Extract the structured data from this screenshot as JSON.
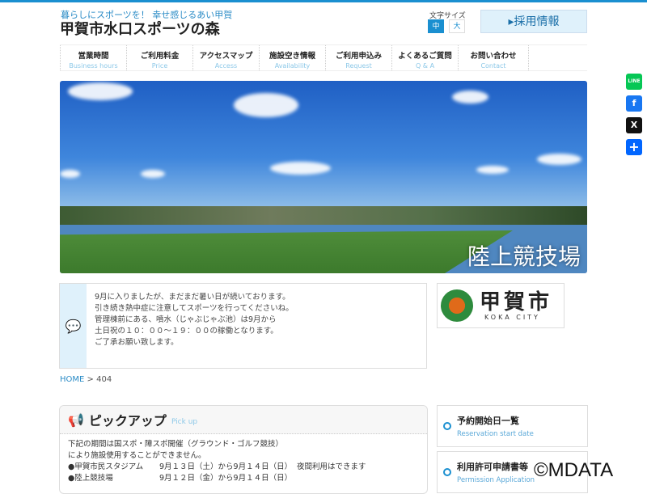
{
  "header": {
    "tagline": "暮らしにスポーツを！ 幸せ感じるあい甲賀",
    "title": "甲賀市水口スポーツの森",
    "font_size_label": "文字サイズ",
    "font_sizes": [
      "中",
      "大"
    ],
    "recruit": "▸採用情報"
  },
  "nav": [
    {
      "ja": "営業時間",
      "en": "Business hours"
    },
    {
      "ja": "ご利用料金",
      "en": "Price"
    },
    {
      "ja": "アクセスマップ",
      "en": "Access"
    },
    {
      "ja": "施設空き情報",
      "en": "Availability"
    },
    {
      "ja": "ご利用申込み",
      "en": "Request"
    },
    {
      "ja": "よくあるご質問",
      "en": "Q & A"
    },
    {
      "ja": "お問い合わせ",
      "en": "Contact"
    }
  ],
  "hero": {
    "caption": "陸上競技場"
  },
  "notice": {
    "lines": [
      "9月に入りましたが、まだまだ暑い日が続いております。",
      "引き続き熱中症に注意してスポーツを行ってくださいね。",
      "管理棟前にある、噴水（じゃぶじゃぶ池）は9月から",
      "土日祝の１０：００～１９：００の稼働となります。",
      "ご了承お願い致します。"
    ]
  },
  "logo": {
    "kanji": "甲賀市",
    "en": "KOKA CITY"
  },
  "breadcrumb": {
    "home": "HOME",
    "sep": ">",
    "current": "404"
  },
  "pickup": {
    "title": "ピックアップ",
    "en": "Pick up",
    "lines": [
      "下記の期間は国スポ・障スポ開催（グラウンド・ゴルフ競技）",
      "により施設使用することができません。"
    ],
    "rows": [
      {
        "place": "●甲賀市民スタジアム",
        "dates": "9月１３日（土）から9月１４日（日）",
        "note": "夜間利用はできます"
      },
      {
        "place": "●陸上競技場",
        "dates": "9月１２日（金）から9月１４日（日）",
        "note": ""
      }
    ]
  },
  "side": [
    {
      "title": "予約開始日一覧",
      "en": "Reservation start date"
    },
    {
      "title": "利用許可申請書等",
      "en": "Permission Application"
    }
  ],
  "share": [
    {
      "icon": "line-icon",
      "label": "LINE",
      "color": "#06c755"
    },
    {
      "icon": "facebook-icon",
      "label": "f",
      "color": "#1877f2"
    },
    {
      "icon": "x-icon",
      "label": "X",
      "color": "#111111"
    },
    {
      "icon": "share-plus-icon",
      "label": "+",
      "color": "#0166ff"
    }
  ],
  "watermark": "©MDATA"
}
